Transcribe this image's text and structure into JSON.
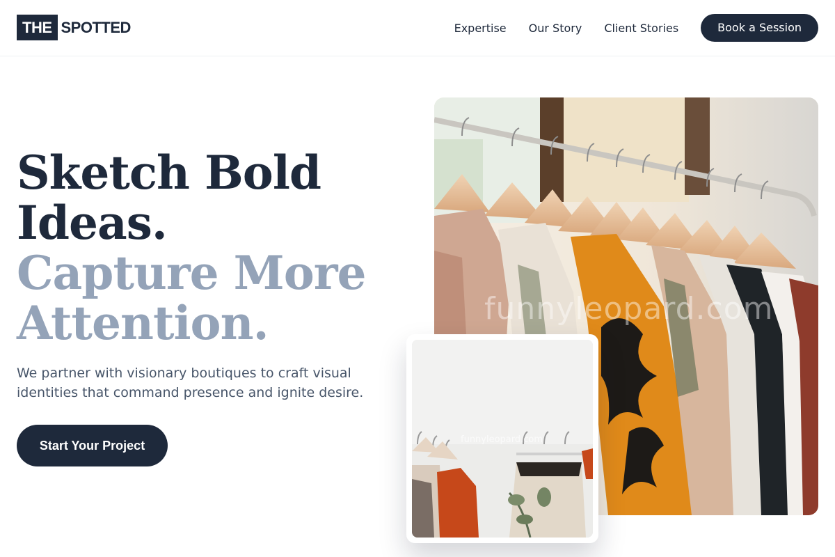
{
  "brand": {
    "logo_box": "THE",
    "logo_text": "SPOTTED"
  },
  "nav": {
    "items": [
      "Expertise",
      "Our Story",
      "Client Stories"
    ],
    "cta": "Book a Session"
  },
  "hero": {
    "title_line1": "Sketch Bold",
    "title_line2": "Ideas.",
    "title_line3": "Capture More",
    "title_line4": "Attention.",
    "subtitle": "We partner with visionary boutiques to craft visual identities that command presence and ignite desire.",
    "cta": "Start Your Project"
  },
  "images": {
    "main_watermark": "funnyleopard.com",
    "small_watermark": "funnyleopard.com"
  },
  "colors": {
    "primary": "#1e293b",
    "accent_light": "#94a3b8",
    "body_text": "#475569"
  }
}
